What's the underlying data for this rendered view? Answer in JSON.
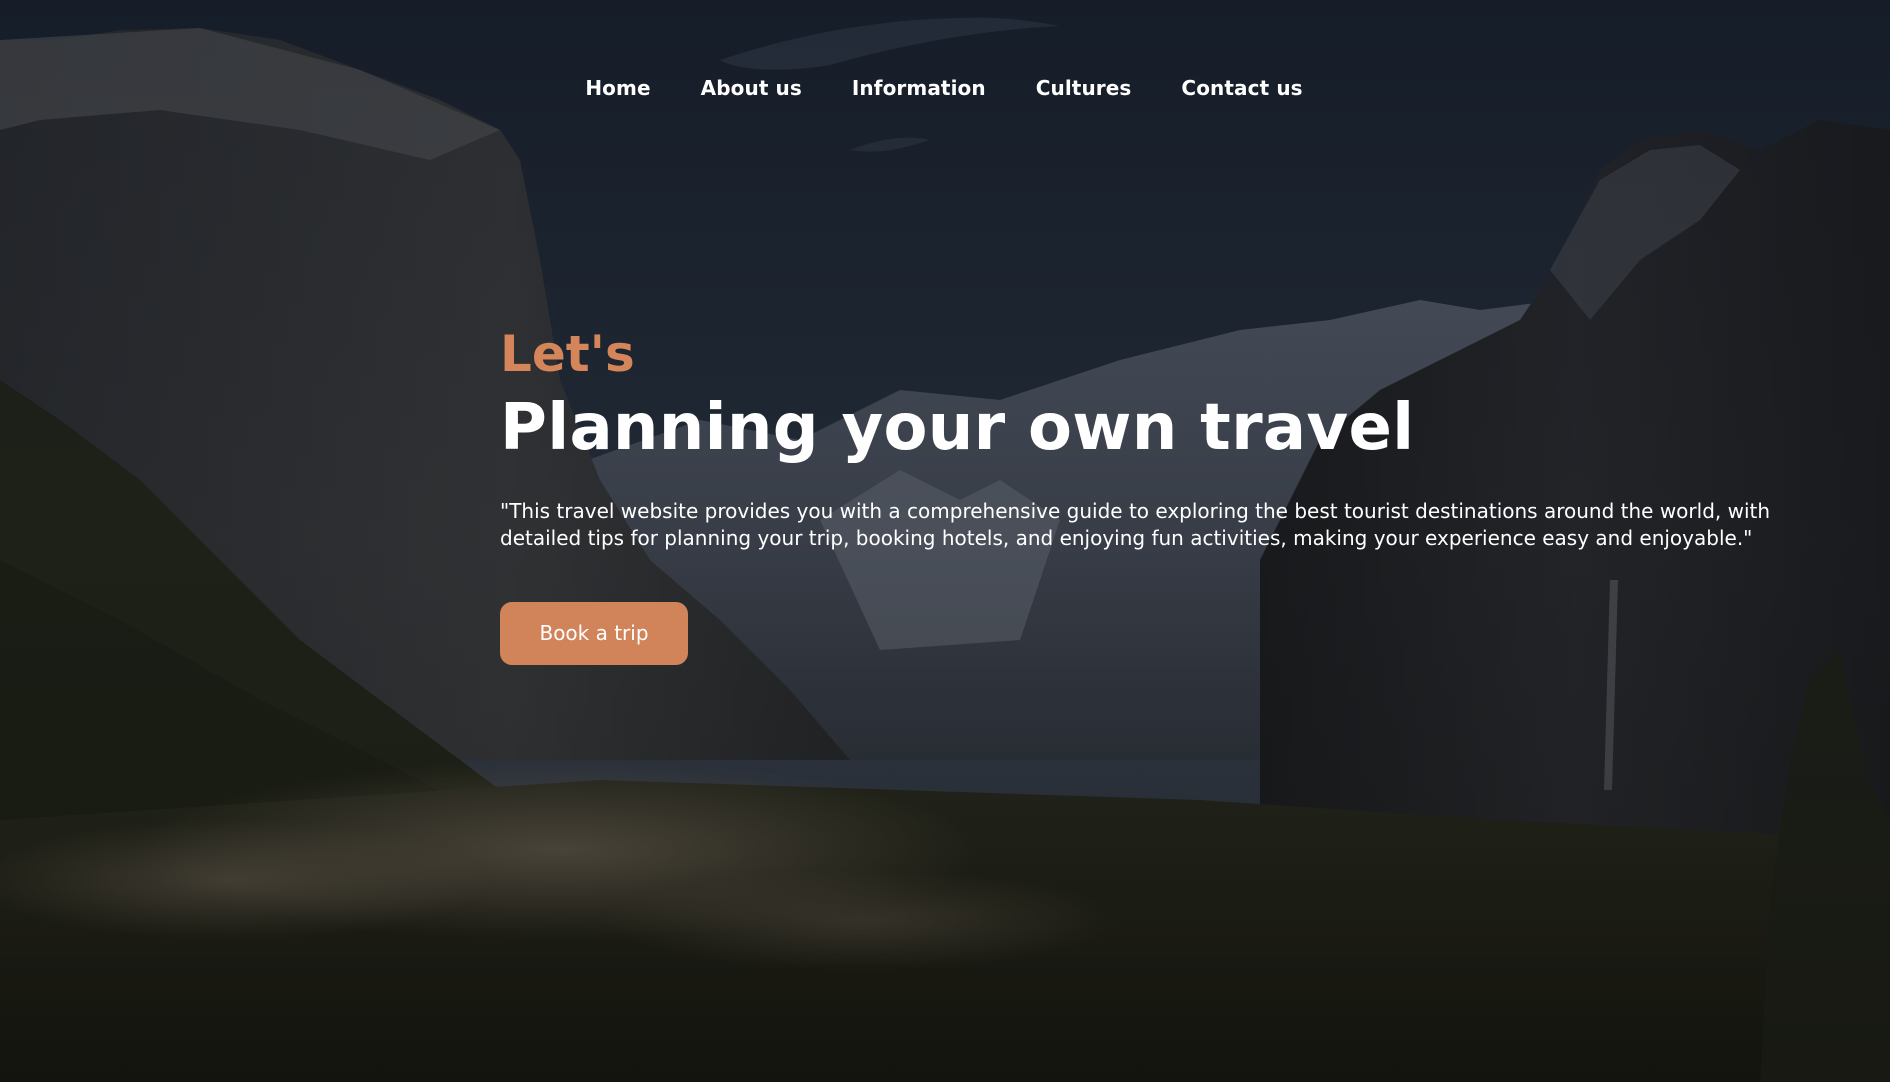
{
  "nav": {
    "items": [
      {
        "label": "Home"
      },
      {
        "label": "About us"
      },
      {
        "label": "Information"
      },
      {
        "label": "Cultures"
      },
      {
        "label": "Contact us"
      }
    ]
  },
  "hero": {
    "eyebrow": "Let's",
    "headline": "Planning your own travel",
    "description": "\"This travel website provides you with a comprehensive guide to exploring the best tourist destinations around the world, with detailed tips for planning your trip, booking hotels, and enjoying fun activities, making your experience easy and enjoyable.\"",
    "cta_label": "Book a trip"
  },
  "colors": {
    "accent": "#d1835a",
    "text": "#ffffff",
    "background": "#1b2430"
  }
}
